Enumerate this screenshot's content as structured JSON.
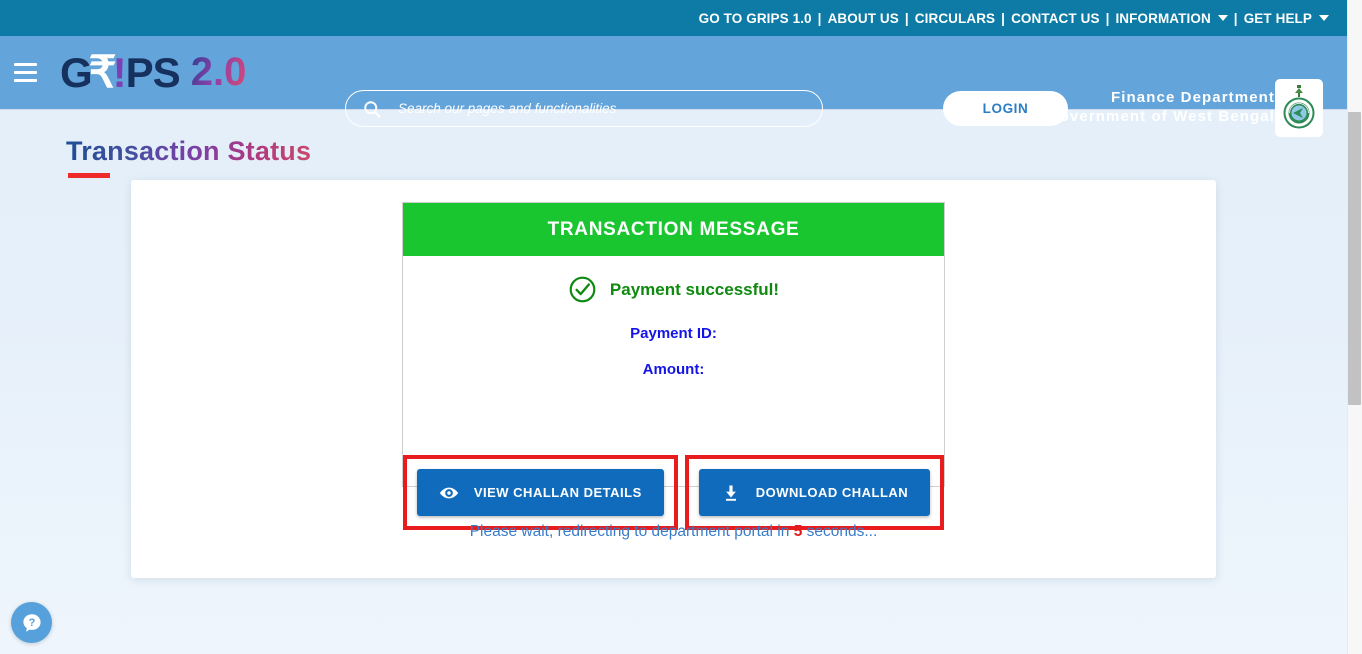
{
  "topnav": {
    "items": [
      {
        "label": "GO TO GRIPS 1.0",
        "dropdown": false
      },
      {
        "label": "ABOUT US",
        "dropdown": false
      },
      {
        "label": "CIRCULARS",
        "dropdown": false
      },
      {
        "label": "CONTACT US",
        "dropdown": false
      },
      {
        "label": "INFORMATION",
        "dropdown": true
      },
      {
        "label": "GET HELP",
        "dropdown": true
      }
    ],
    "separator": "|"
  },
  "header": {
    "logo": {
      "prefix": "G",
      "rupee": "₹",
      "bang": "!",
      "suffix": "PS",
      "version": "2.0"
    },
    "search": {
      "placeholder": "Search our pages and functionalities",
      "value": "",
      "icon": "search-icon"
    },
    "login_label": "LOGIN",
    "department_line1": "Finance Department",
    "department_line2": "Government of West Bengal",
    "emblem_alt": "west-bengal-government-emblem"
  },
  "page": {
    "title": "Transaction Status"
  },
  "transaction": {
    "panel_title": "TRANSACTION MESSAGE",
    "status_message": "Payment successful!",
    "status_icon": "check-circle-icon",
    "payment_id_label": "Payment ID:",
    "payment_id_value": "",
    "amount_label": "Amount:",
    "amount_value": "",
    "buttons": [
      {
        "label": "VIEW CHALLAN DETAILS",
        "icon": "eye-icon",
        "highlighted": true
      },
      {
        "label": "DOWNLOAD CHALLAN",
        "icon": "download-icon",
        "highlighted": true
      }
    ],
    "redirect_prefix": "Please wait, redirecting to department portal in",
    "redirect_seconds": "5",
    "redirect_suffix": "seconds..."
  },
  "help": {
    "icon": "help-question-icon",
    "label": "?"
  },
  "colors": {
    "topbar": "#0d7ba5",
    "header": "#63a4db",
    "success_green": "#1ac62f",
    "success_text": "#0f8a0f",
    "button_blue": "#106bbd",
    "highlight_red": "#e81c1c",
    "link_blue": "#3a7bc8",
    "label_blue": "#1414e6"
  }
}
